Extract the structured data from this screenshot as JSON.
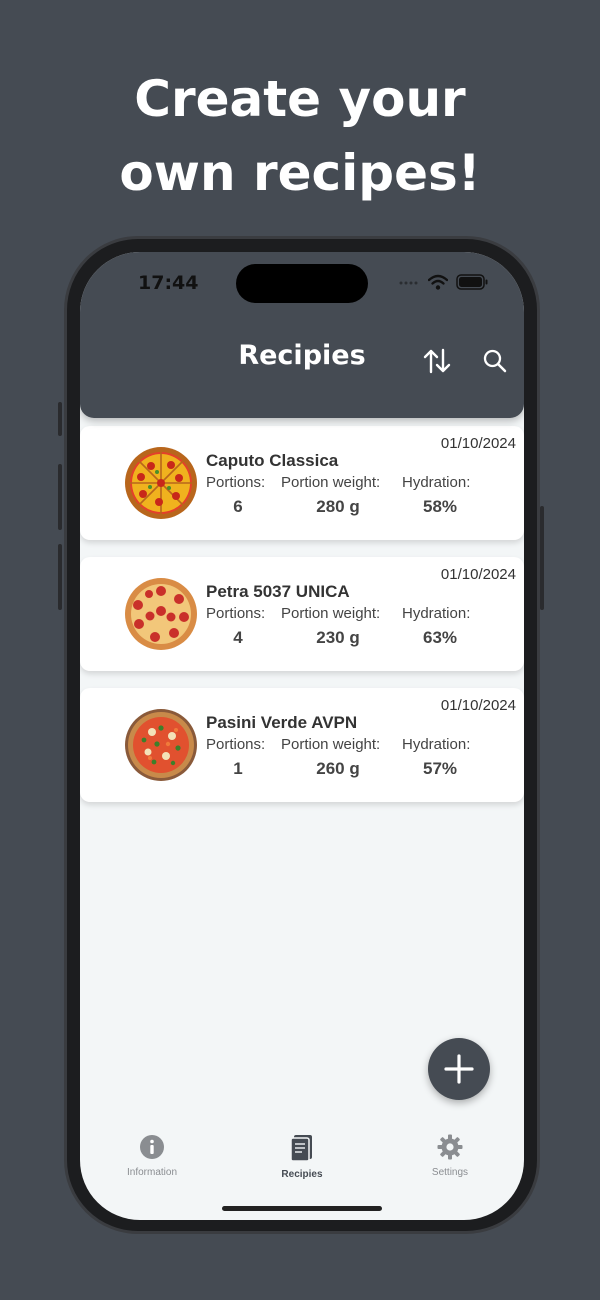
{
  "promo": {
    "headline_line1": "Create your",
    "headline_line2": "own recipes!"
  },
  "status_bar": {
    "time": "17:44"
  },
  "header": {
    "title": "Recipies"
  },
  "recipes": [
    {
      "name": "Caputo Classica",
      "date": "01/10/2024",
      "portions_label": "Portions:",
      "portion_weight_label": "Portion weight:",
      "hydration_label": "Hydration:",
      "portions": "6",
      "portion_weight": "280 g",
      "hydration": "58%"
    },
    {
      "name": "Petra 5037 UNICA",
      "date": "01/10/2024",
      "portions_label": "Portions:",
      "portion_weight_label": "Portion weight:",
      "hydration_label": "Hydration:",
      "portions": "4",
      "portion_weight": "230 g",
      "hydration": "63%"
    },
    {
      "name": "Pasini Verde AVPN",
      "date": "01/10/2024",
      "portions_label": "Portions:",
      "portion_weight_label": "Portion weight:",
      "hydration_label": "Hydration:",
      "portions": "1",
      "portion_weight": "260 g",
      "hydration": "57%"
    }
  ],
  "tabs": [
    {
      "label": "Information",
      "icon": "info-icon"
    },
    {
      "label": "Recipies",
      "icon": "recipe-book-icon"
    },
    {
      "label": "Settings",
      "icon": "gear-icon"
    }
  ],
  "colors": {
    "background": "#454b53",
    "header": "#454b53",
    "screen": "#f3f6f7",
    "card": "#ffffff"
  }
}
